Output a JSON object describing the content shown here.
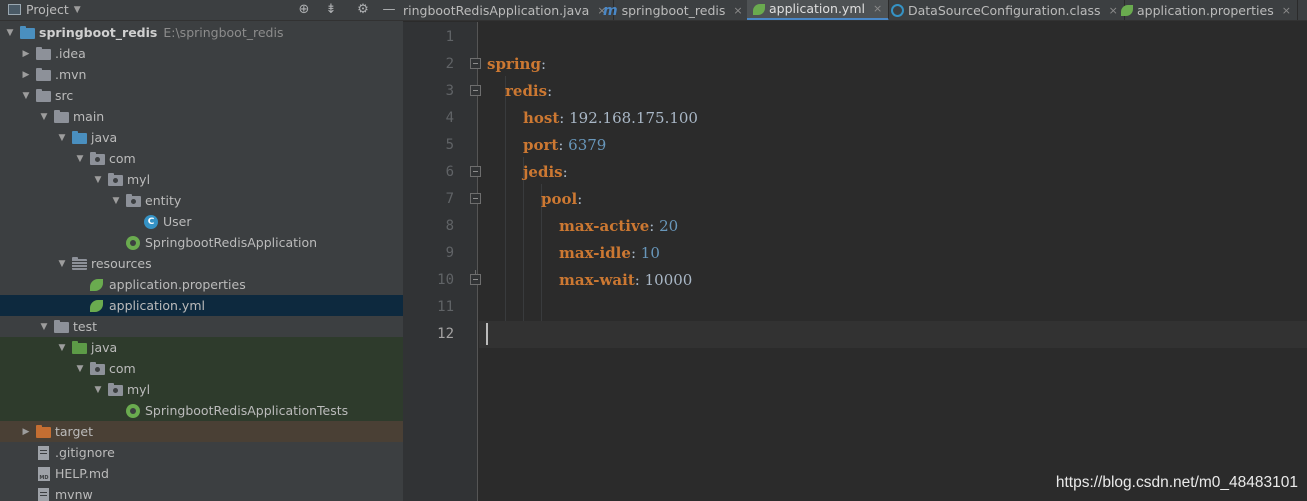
{
  "project_panel": {
    "title": "Project",
    "toolbar_icons": [
      "target-icon",
      "collapse-icon",
      "gear-icon",
      "hide-icon"
    ]
  },
  "tree": {
    "root": {
      "label": "springboot_redis",
      "path": "E:\\springboot_redis"
    },
    "idea": ".idea",
    "mvn": ".mvn",
    "src": "src",
    "main": "main",
    "main_java": "java",
    "main_com": "com",
    "main_myl": "myl",
    "entity": "entity",
    "user": "User",
    "app_class": "SpringbootRedisApplication",
    "resources": "resources",
    "app_props": "application.properties",
    "app_yml": "application.yml",
    "test": "test",
    "test_java": "java",
    "test_com": "com",
    "test_myl": "myl",
    "test_class": "SpringbootRedisApplicationTests",
    "target": "target",
    "gitignore": ".gitignore",
    "help": "HELP.md",
    "mvnw": "mvnw"
  },
  "tabs": [
    {
      "label": "ringbootRedisApplication.java",
      "active": false
    },
    {
      "label": "springboot_redis",
      "active": false
    },
    {
      "label": "application.yml",
      "active": true
    },
    {
      "label": "DataSourceConfiguration.class",
      "active": false
    },
    {
      "label": "application.properties",
      "active": false
    }
  ],
  "tab_close_glyph": "×",
  "editor": {
    "line_numbers": [
      "1",
      "2",
      "3",
      "4",
      "5",
      "6",
      "7",
      "8",
      "9",
      "10",
      "11",
      "12"
    ],
    "current_line": 12,
    "lines": {
      "l2_key": "spring",
      "l3_key": "redis",
      "l4_key": "host",
      "l4_val": "192.168.175.100",
      "l5_key": "port",
      "l5_val": "6379",
      "l6_key": "jedis",
      "l7_key": "pool",
      "l8_key": "max-active",
      "l8_val": "20",
      "l9_key": "max-idle",
      "l9_val": "10",
      "l10_key": "max-wait",
      "l10_val": "10000"
    },
    "colon": ":"
  },
  "watermark": "https://blog.csdn.net/m0_48483101",
  "colors": {
    "panel_bg": "#3c3f41",
    "editor_bg": "#2b2b2b",
    "selection": "#0d293e",
    "yaml_key": "#cc7832",
    "number": "#6897bb",
    "accent": "#4a88c7"
  }
}
